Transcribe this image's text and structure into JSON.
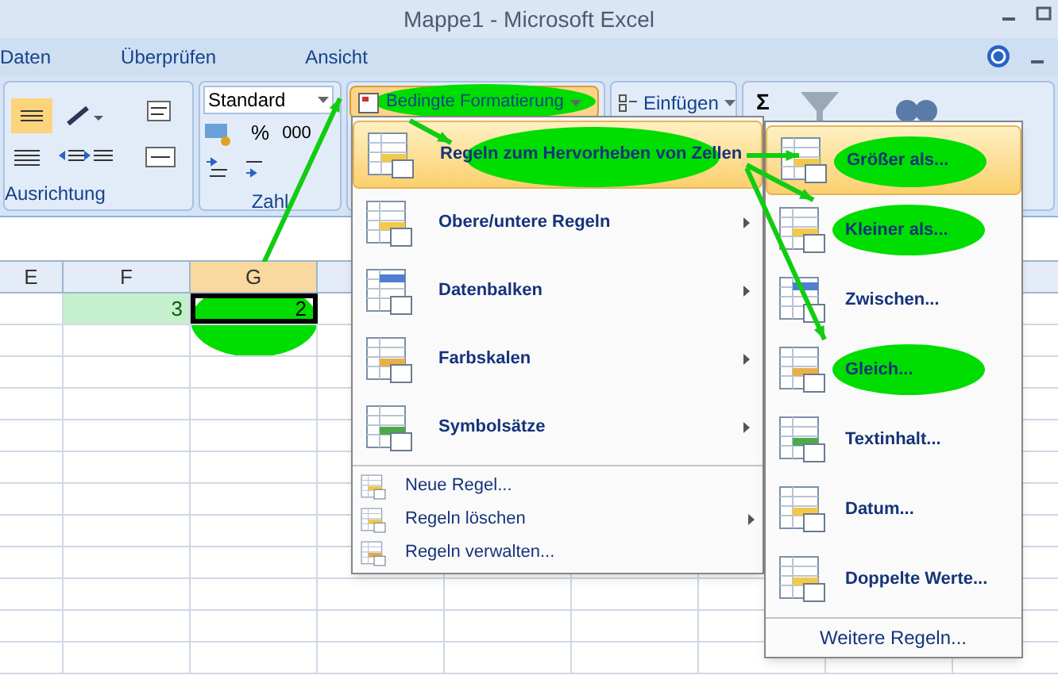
{
  "window": {
    "title": "Mappe1 - Microsoft Excel"
  },
  "tabs": [
    {
      "label": "Daten",
      "selected": false
    },
    {
      "label": "Überprüfen",
      "selected": false
    },
    {
      "label": "Ansicht",
      "selected": false
    }
  ],
  "ribbon": {
    "groups": [
      {
        "label": "Ausrichtung"
      },
      {
        "label": "Zahl"
      }
    ],
    "number_format": "Standard",
    "percent": "%",
    "thousands": "000",
    "cond_format": {
      "label": "Bedingte Formatierung",
      "marked": true
    },
    "insert": "Einfügen",
    "sum": "Σ"
  },
  "columns": [
    {
      "label": "E",
      "selected": false
    },
    {
      "label": "F",
      "selected": false
    },
    {
      "label": "G",
      "selected": true
    }
  ],
  "cells": [
    {
      "value": "3",
      "highlighted": true,
      "selected": false
    },
    {
      "value": "2",
      "highlighted": false,
      "selected": true,
      "marked": true
    }
  ],
  "menu": {
    "items": [
      {
        "kind": "large",
        "label": "Regeln zum Hervorheben von Zellen",
        "selected": true,
        "submenu": true,
        "marked": true
      },
      {
        "kind": "large",
        "label": "Obere/untere Regeln",
        "selected": false,
        "submenu": true,
        "marked": false
      },
      {
        "kind": "large",
        "label": "Datenbalken",
        "selected": false,
        "submenu": true,
        "marked": false
      },
      {
        "kind": "large",
        "label": "Farbskalen",
        "selected": false,
        "submenu": true,
        "marked": false
      },
      {
        "kind": "large",
        "label": "Symbolsätze",
        "selected": false,
        "submenu": true,
        "marked": false
      },
      {
        "kind": "small",
        "label": "Neue Regel...",
        "selected": false,
        "submenu": false,
        "marked": false
      },
      {
        "kind": "small",
        "label": "Regeln löschen",
        "selected": false,
        "submenu": true,
        "marked": false
      },
      {
        "kind": "small",
        "label": "Regeln verwalten...",
        "selected": false,
        "submenu": false,
        "marked": false
      }
    ]
  },
  "submenu": {
    "items": [
      {
        "label": "Größer als...",
        "selected": true,
        "marked": true
      },
      {
        "label": "Kleiner als...",
        "selected": false,
        "marked": true
      },
      {
        "label": "Zwischen...",
        "selected": false,
        "marked": false
      },
      {
        "label": "Gleich...",
        "selected": false,
        "marked": true
      },
      {
        "label": "Textinhalt...",
        "selected": false,
        "marked": false
      },
      {
        "label": "Datum...",
        "selected": false,
        "marked": false
      },
      {
        "label": "Doppelte Werte...",
        "selected": false,
        "marked": false
      }
    ],
    "footer": "Weitere Regeln..."
  }
}
